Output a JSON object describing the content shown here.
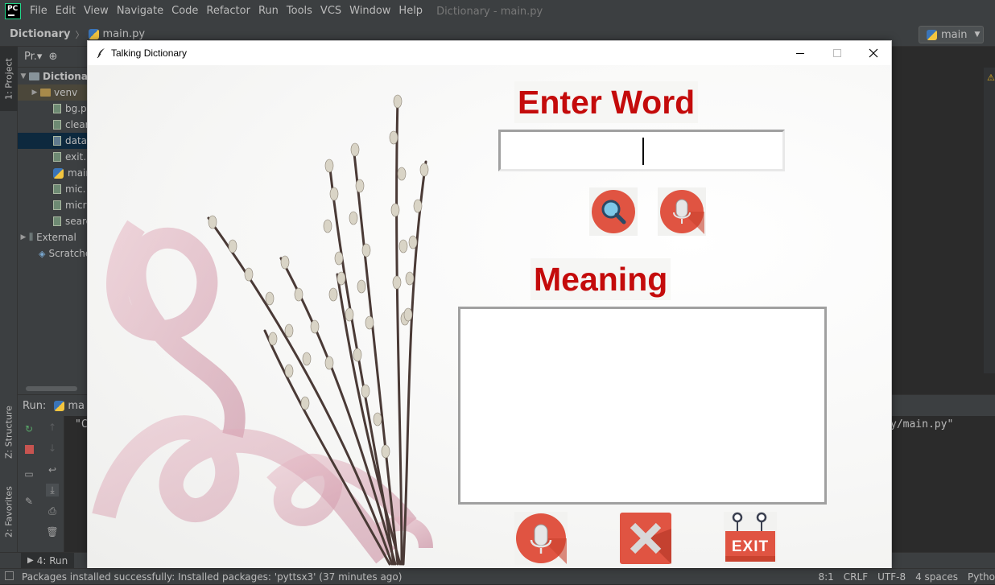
{
  "menubar": {
    "items": [
      "File",
      "Edit",
      "View",
      "Navigate",
      "Code",
      "Refactor",
      "Run",
      "Tools",
      "VCS",
      "Window",
      "Help"
    ],
    "window_title": "Dictionary - main.py"
  },
  "navbar": {
    "project": "Dictionary",
    "file": "main.py",
    "run_config": "main"
  },
  "left_stripe": {
    "project_tab": "1: Project",
    "structure_tab": "Z: Structure",
    "favorites_tab": "2: Favorites"
  },
  "project_panel": {
    "header": "Pr.",
    "root": "Dictiona",
    "items": [
      {
        "label": "venv",
        "kind": "folder"
      },
      {
        "label": "bg.p",
        "kind": "file"
      },
      {
        "label": "clear",
        "kind": "file"
      },
      {
        "label": "data.",
        "kind": "file"
      },
      {
        "label": "exit.p",
        "kind": "file"
      },
      {
        "label": "main",
        "kind": "file"
      },
      {
        "label": "mic.",
        "kind": "file"
      },
      {
        "label": "micr",
        "kind": "file"
      },
      {
        "label": "searc",
        "kind": "file"
      }
    ],
    "external": "External",
    "scratches": "Scratche"
  },
  "run_panel": {
    "label": "Run:",
    "tab": "ma",
    "console_left": "\"C",
    "console_right": "y/main.py\""
  },
  "bottom_toolbar": {
    "run_tab": "4: Run"
  },
  "statusbar": {
    "message": "Packages installed successfully: Installed packages: 'pyttsx3' (37 minutes ago)",
    "position": "8:1",
    "line_sep": "CRLF",
    "encoding": "UTF-8",
    "indent": "4 spaces",
    "interpreter": "Pytho"
  },
  "tk": {
    "title": "Talking Dictionary",
    "enter_word": "Enter Word",
    "meaning": "Meaning",
    "word_value": "",
    "meaning_value": "",
    "exit_label": "EXIT"
  },
  "colors": {
    "heading_red": "#c40b0b",
    "button_red": "#e05442",
    "ide_bg": "#2b2b2b",
    "ide_panel": "#3c3f41"
  }
}
